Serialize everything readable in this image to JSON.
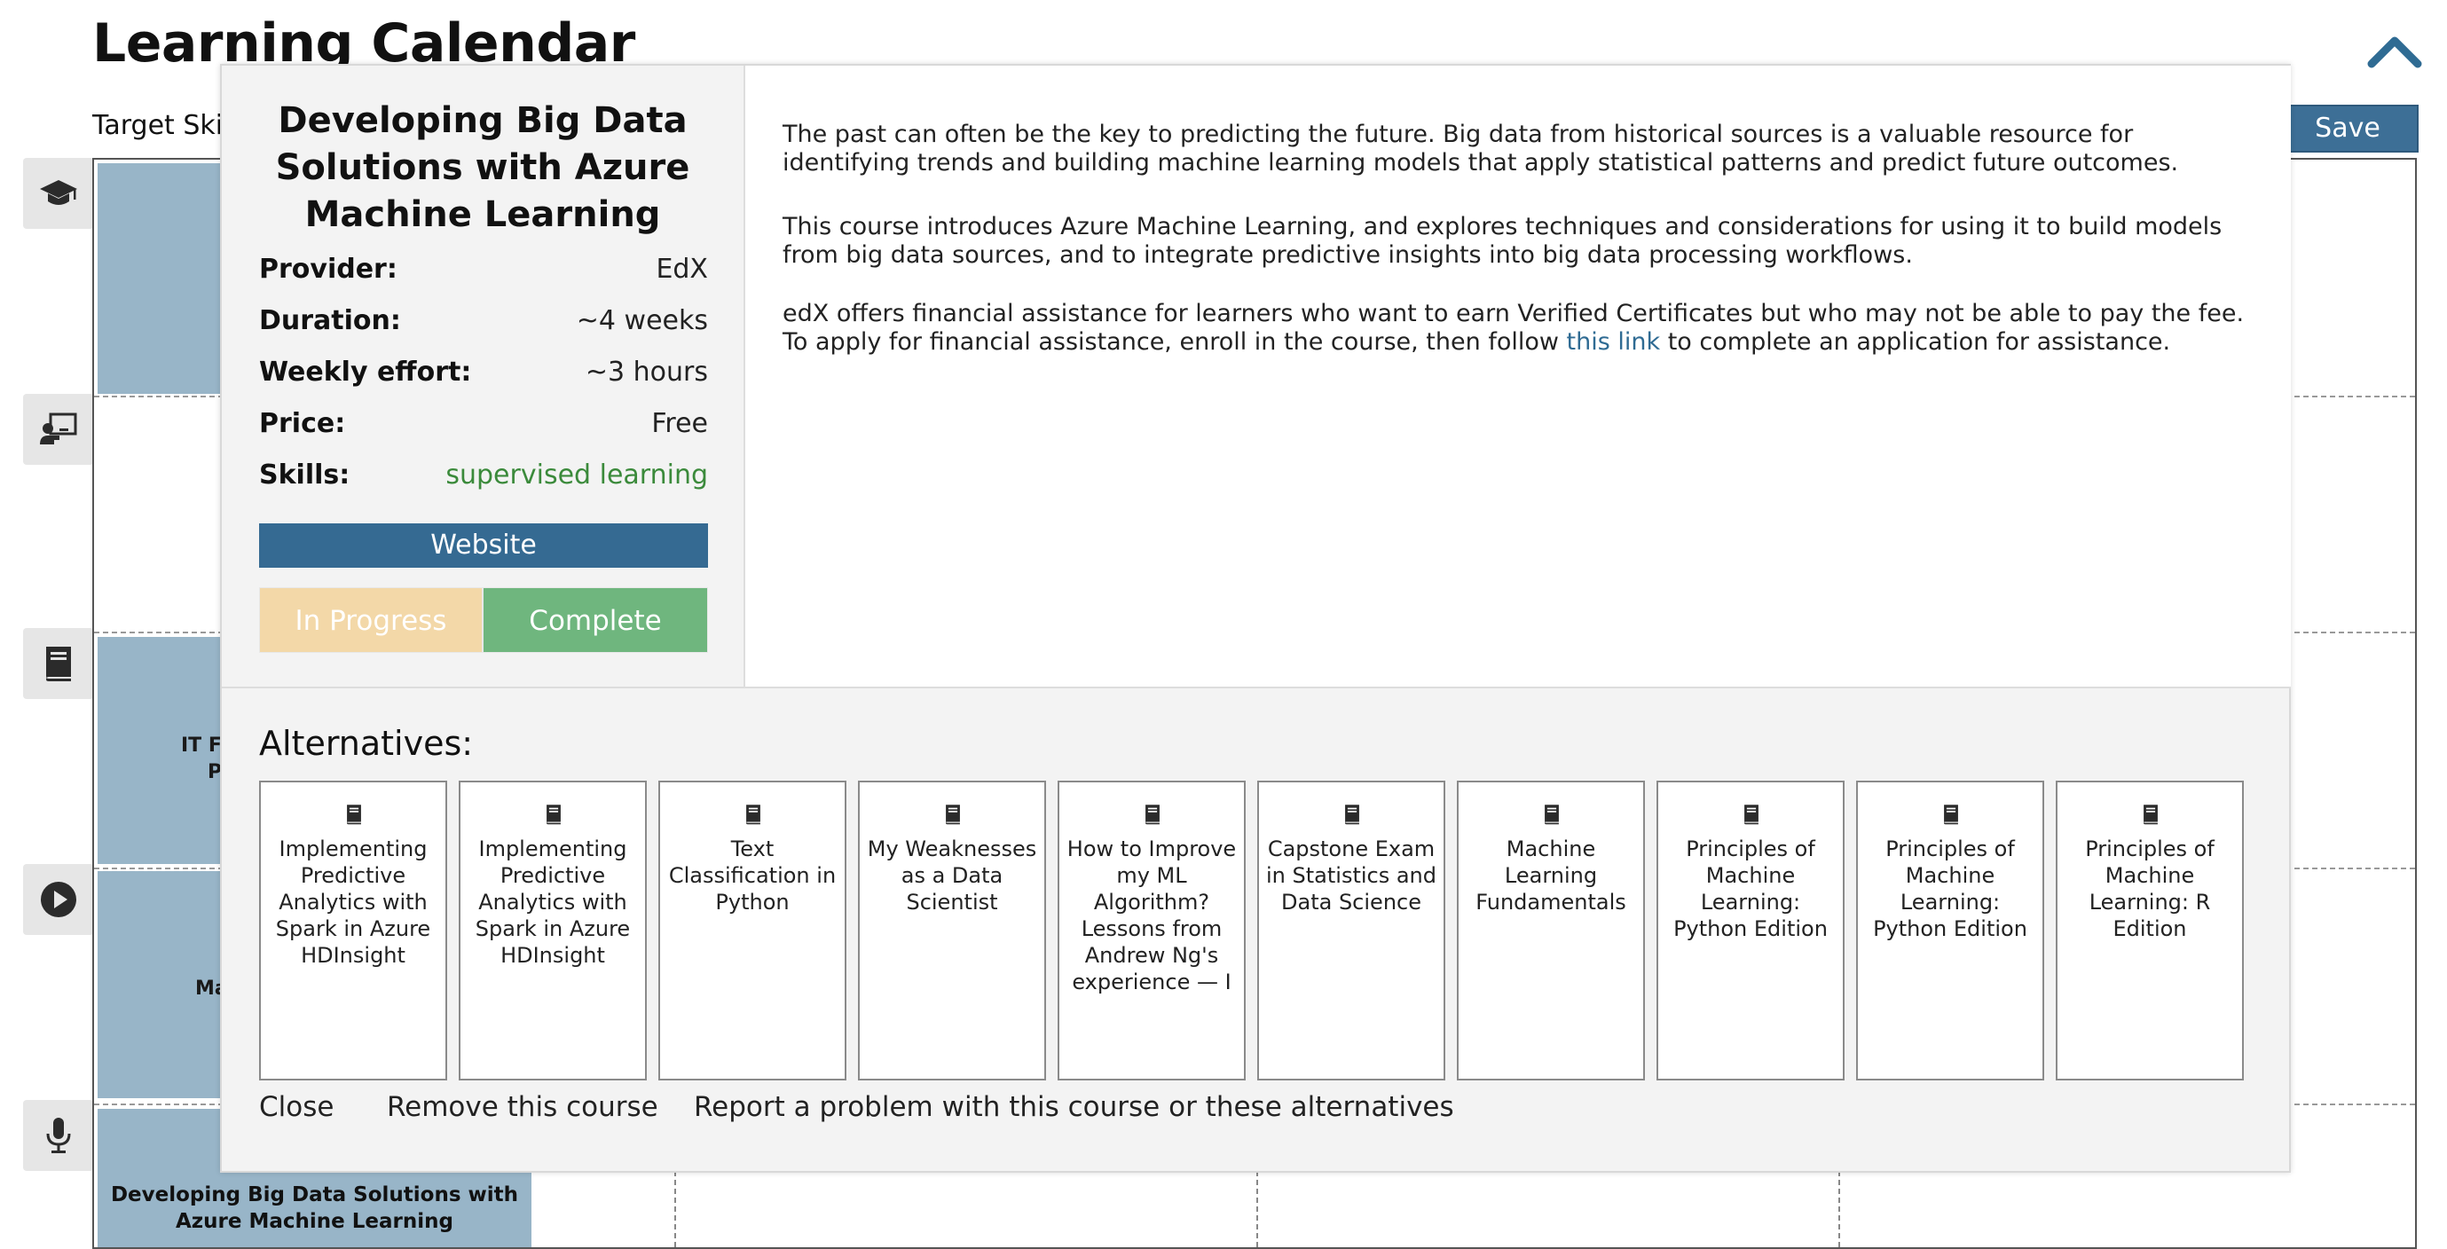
{
  "page": {
    "title": "Learning Calendar",
    "target_label": "Target Skil",
    "save_label": "Save"
  },
  "background_cards": {
    "card3_fragment_a": "IT Fu",
    "card3_fragment_b": "Pr",
    "card4_fragment": "Ma",
    "card5_title": "Developing Big Data Solutions with Azure Machine Learning"
  },
  "modal": {
    "course_title": "Developing Big Data Solutions with Azure Machine Learning",
    "info": [
      {
        "label": "Provider:",
        "value": "EdX"
      },
      {
        "label": "Duration:",
        "value": "~4 weeks"
      },
      {
        "label": "Weekly effort:",
        "value": "~3 hours"
      },
      {
        "label": "Price:",
        "value": "Free"
      },
      {
        "label": "Skills:",
        "value": "supervised learning"
      }
    ],
    "website_label": "Website",
    "in_progress_label": "In Progress",
    "complete_label": "Complete",
    "description": {
      "p1": "The past can often be the key to predicting the future. Big data from historical sources is a valuable resource for identifying trends and building machine learning models that apply statistical patterns and predict future outcomes.",
      "p2": "This course introduces Azure Machine Learning, and explores techniques and considerations for using it to build models from big data sources, and to integrate predictive insights into big data processing workflows.",
      "p3_before": "edX offers financial assistance for learners who want to earn Verified Certificates but who may not be able to pay the fee. To apply for financial assistance, enroll in the course, then follow ",
      "p3_link": "this link",
      "p3_after": " to complete an application for assistance."
    },
    "alternatives_heading": "Alternatives:",
    "alternatives": [
      "Implementing Predictive Analytics with Spark in Azure HDInsight",
      "Implementing Predictive Analytics with Spark in Azure HDInsight",
      "Text Classification in Python",
      "My Weaknesses as a Data Scientist",
      "How to Improve my ML Algorithm? Lessons from Andrew Ng's experience — I",
      "Capstone Exam in Statistics and Data Science",
      "Machine Learning Fundamentals",
      "Principles of Machine Learning: Python Edition",
      "Principles of Machine Learning: Python Edition",
      "Principles of Machine Learning: R Edition"
    ],
    "footer": {
      "close": "Close",
      "remove": "Remove this course",
      "report": "Report a problem with this course or these alternatives"
    }
  },
  "colors": {
    "accent": "#356a92",
    "card_bg": "#98b5c8",
    "complete": "#6fb67e",
    "in_progress": "#f3d8a8",
    "skill_text": "#3b8a3b"
  },
  "sidebar_icons": [
    "graduation-cap-icon",
    "teacher-board-icon",
    "book-icon",
    "play-icon",
    "microphone-icon"
  ]
}
